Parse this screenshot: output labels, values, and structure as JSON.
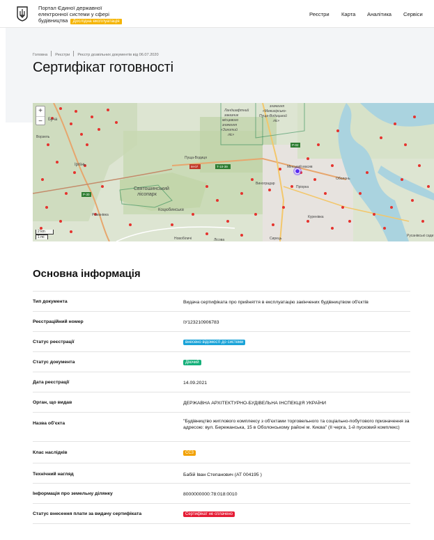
{
  "header": {
    "brand_line": "Портал Єдиної державної електронної системи у сфері будівництва",
    "test_badge": "Дослідна експлуатація",
    "nav": [
      "Реєстри",
      "Карта",
      "Аналітика",
      "Сервіси"
    ]
  },
  "breadcrumbs": [
    "Головна",
    "Реєстри",
    "Реєстр дозвільних документів від 06.07.2020"
  ],
  "page_title": "Сертифікат готовності",
  "map": {
    "zoom_in": "+",
    "zoom_out": "−",
    "scale_km": "2 km",
    "scale_mi": "1 mi",
    "labels": {
      "a": "Ландшафтний заказник місцевого значення «Пуща-Водиця»",
      "b": "Пуща-Водиця",
      "c": "Святошинський лісопарк",
      "d": "Ірпінь",
      "e": "Буча",
      "f": "Ворзель",
      "g": "Коцюбинське",
      "h": "Романівка",
      "i": "Виноградар",
      "j": "Мінський масив",
      "k": "Оболонь",
      "l": "Пріорка",
      "m": "Куренівка",
      "n": "Русанівські сади",
      "o": "Новобіличі",
      "p": "Лісова",
      "q": "Сирець",
      "r": "Ландшафтний заказник загальнодержавного значення «Межигірсько-Пуща-Водицький ліс»",
      "s": "Ландшафтний заказник місцевого значення «Золотий ліс»"
    },
    "roads": [
      "М-07",
      "Т-10-39",
      "Р-30",
      "Р-02"
    ]
  },
  "section_title": "Основна інформація",
  "rows": [
    {
      "label": "Тип документа",
      "value": "Видача сертифіката про прийняття в експлуатацію закінчених будівництвом об'єктів"
    },
    {
      "label": "Реєстраційний номер",
      "value": "ІУ123210906783"
    },
    {
      "label": "Статус реєстрації",
      "tag": "внесено відомості до системи",
      "tag_color": "#1aa3d8"
    },
    {
      "label": "Статус документа",
      "tag": "Діючий",
      "tag_color": "#16b07a"
    },
    {
      "label": "Дата реєстрації",
      "value": "14.09.2021"
    },
    {
      "label": "Орган, що видав",
      "value": "ДЕРЖАВНА АРХІТЕКТУРНО-БУДІВЕЛЬНА ІНСПЕКЦІЯ УКРАЇНИ"
    },
    {
      "label": "Назва об'єкта",
      "value": "\"Будівництво житлового комплексу з об'єктами торговельного та соціально-побутового призначення за адресою: вул. Бережанська, 15 в Оболонському районі м. Києва\" (ІІ черга, 1-й пусковий комплекс)"
    },
    {
      "label": "Клас наслідків",
      "tag": "СС3",
      "tag_color": "#f2a100"
    },
    {
      "label": "Технічний нагляд",
      "value": "Бабій Іван Степанович (АТ 004195 )"
    },
    {
      "label": "Інформація про земельну ділянку",
      "value": "8000000000:78:018:0010"
    },
    {
      "label": "Статус внесення плати за видачу сертифіката",
      "tag": "Сертифікат не сплачено",
      "tag_color": "#e51c35"
    }
  ]
}
